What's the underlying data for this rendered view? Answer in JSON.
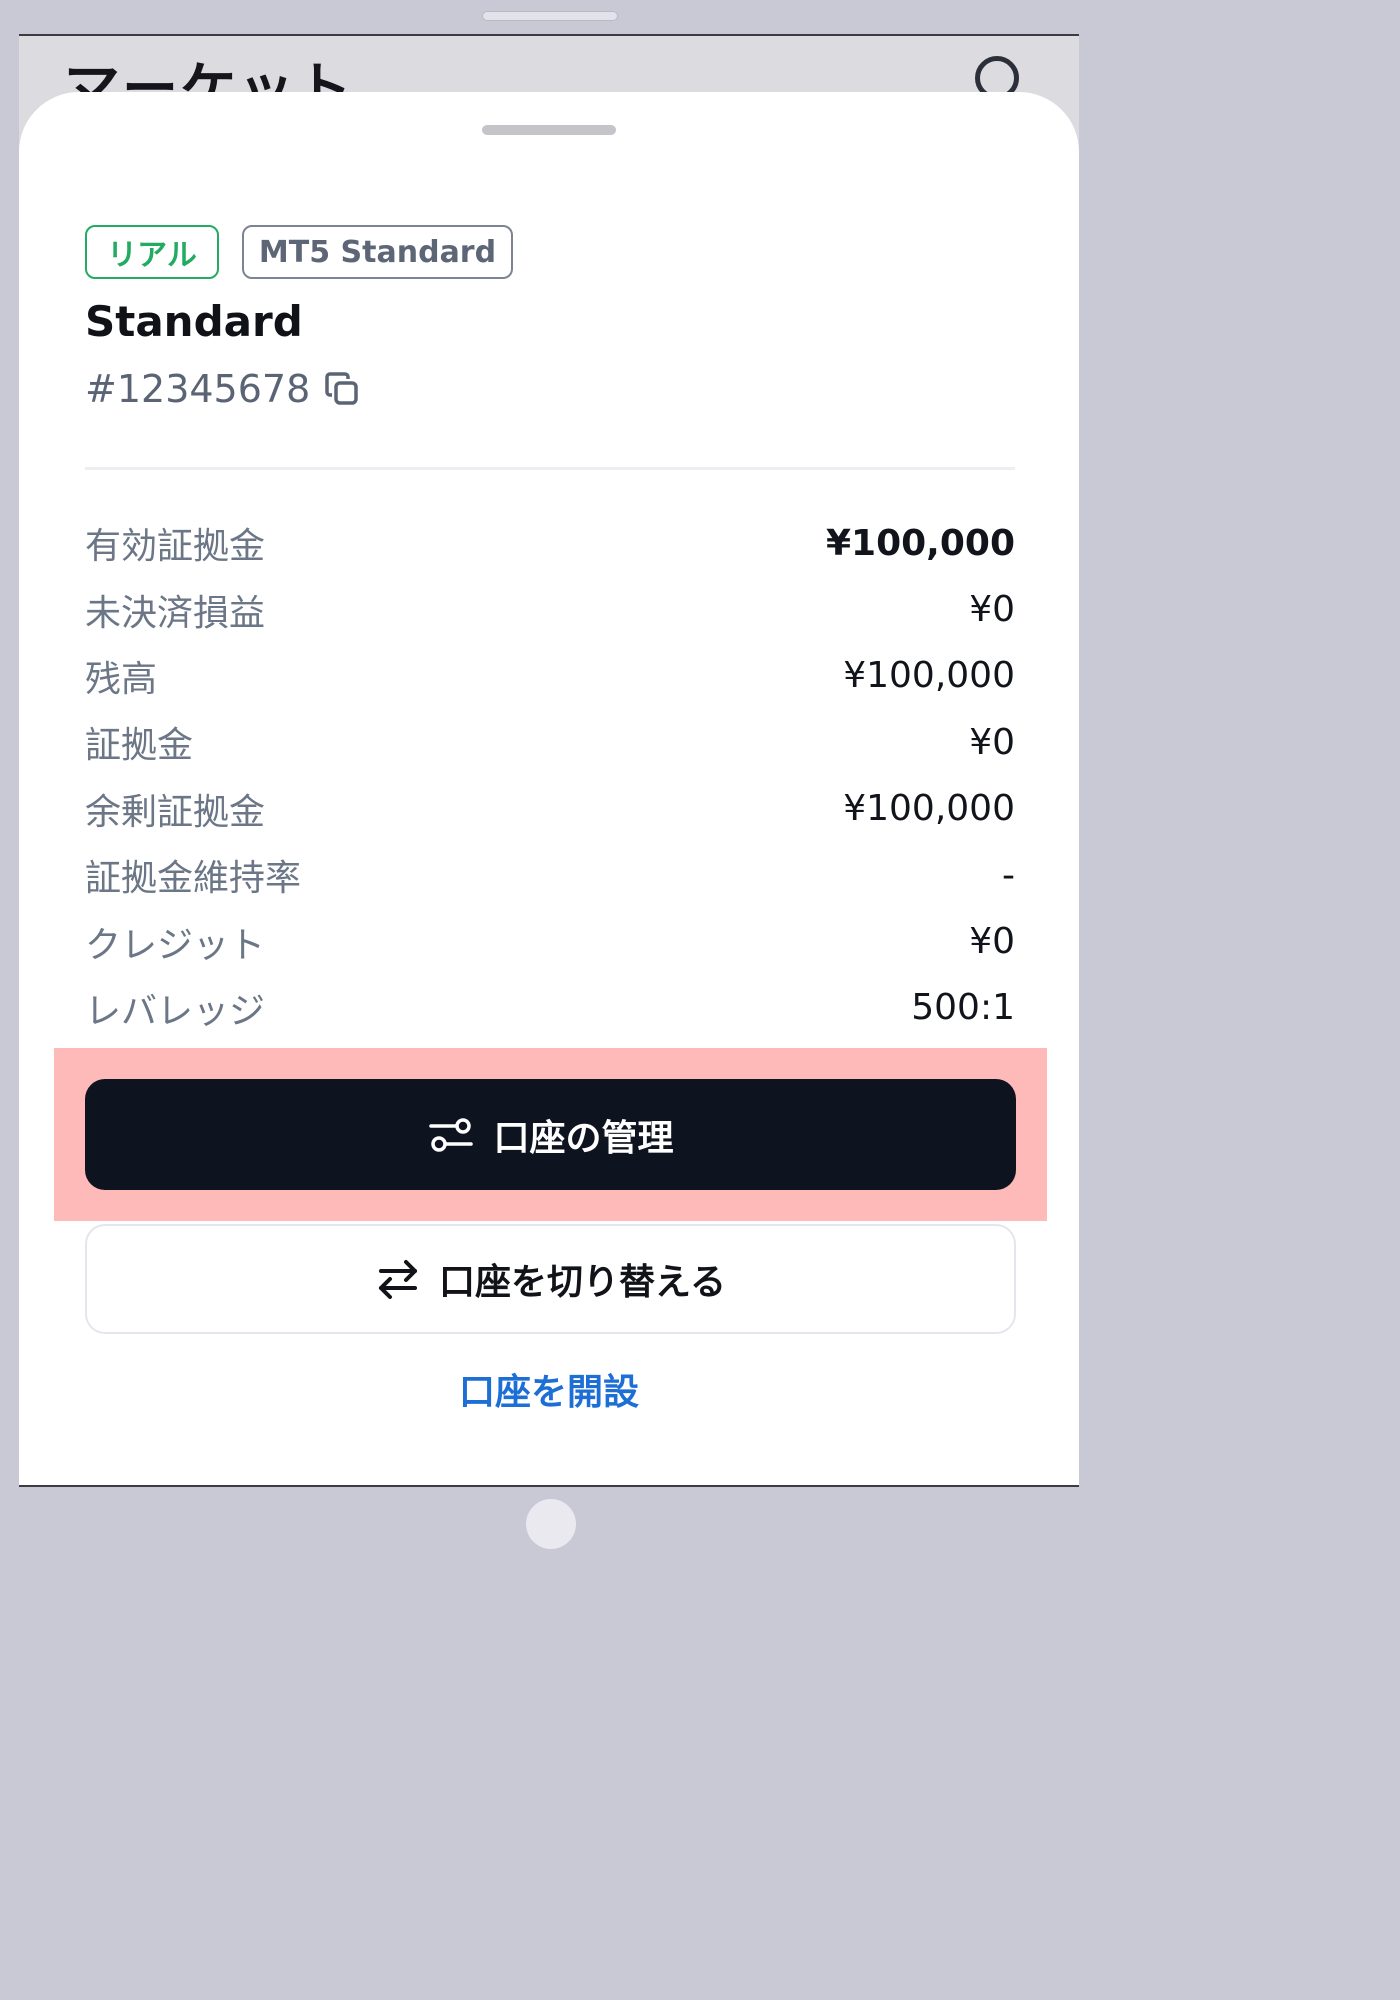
{
  "background": {
    "title": "マーケット",
    "search_icon": "search-icon"
  },
  "account": {
    "badges": {
      "type": "リアル",
      "platform": "MT5 Standard"
    },
    "name": "Standard",
    "number": "#12345678",
    "copy_icon": "copy-icon"
  },
  "stats": [
    {
      "label": "有効証拠金",
      "value": "¥100,000"
    },
    {
      "label": "未決済損益",
      "value": "¥0"
    },
    {
      "label": "残高",
      "value": "¥100,000"
    },
    {
      "label": "証拠金",
      "value": "¥0"
    },
    {
      "label": "余剰証拠金",
      "value": "¥100,000"
    },
    {
      "label": "証拠金維持率",
      "value": "-"
    },
    {
      "label": "クレジット",
      "value": "¥0"
    },
    {
      "label": "レバレッジ",
      "value": "500:1"
    }
  ],
  "actions": {
    "manage_label": "口座の管理",
    "switch_label": "口座を切り替える",
    "open_label": "口座を開設"
  },
  "colors": {
    "real_badge": "#23ab63",
    "primary_button": "#0e1320",
    "link": "#1d6fd6",
    "highlight": "#feb9b9"
  }
}
